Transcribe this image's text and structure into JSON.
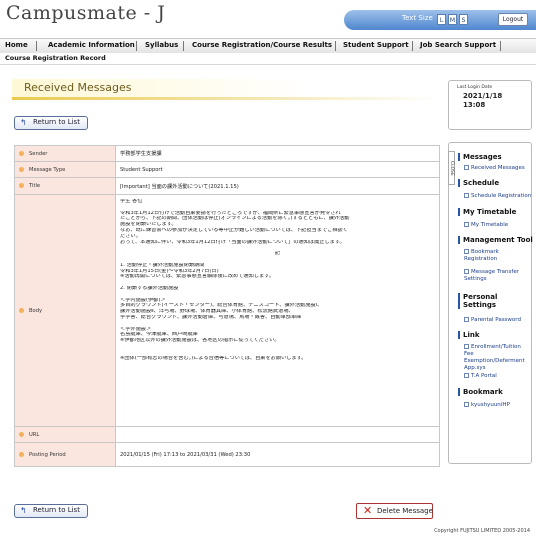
{
  "app": {
    "title": "Campusmate - J"
  },
  "topbar": {
    "text_size_label": "Text Size",
    "size_buttons": [
      "L",
      "M",
      "S"
    ],
    "logout_label": "Logout"
  },
  "nav": {
    "items": [
      "Home",
      "Academic Information",
      "Syllabus",
      "Course Registration/Course Results",
      "Student Support",
      "Job Search Support"
    ]
  },
  "subnav": {
    "items": [
      "Course Registration Record"
    ]
  },
  "page": {
    "title": "Received Messages",
    "return_label": "Return to List",
    "delete_label": "Delete Message"
  },
  "detail": {
    "rows": [
      {
        "label": "Sender",
        "value": "学務部学生支援課"
      },
      {
        "label": "Message Type",
        "value": "Student Support"
      },
      {
        "label": "Title",
        "value": "[Important] 当面の課外活動について(2021.1.15)"
      },
      {
        "label": "Body",
        "lines": [
          "学生 各位",
          "",
          "令和3年1月12日付けで活動自粛要請を行ったところですが、福岡県に緊急事態宣言が発令され",
          "たことから、下記の期間、団体活動は停止(オンラインによる活動を除く。)するとともに、課外活動",
          "施設を閉鎖いたします。",
          "なお、既に練習会への参加が決定している等中止が難しい活動については、下記担当までご相談く",
          "ださい。",
          "おって、本通知に伴い、令和3年1月12日付け「当面の課外活動について」の通知は廃止します。",
          "",
          "記",
          "",
          "1. 活動停止・課外活動施設閉鎖期間",
          "令和3年1月15日(金)～令和3年2月7日(日)",
          "※活動再開については、緊急事態宣言解除後に改めて通知します。",
          "",
          "2. 閉鎖する課外活動施設",
          "",
          "＜学内施設(伊都)＞",
          "多目的グラウンド(イースト・センター)、総合体育館、テニスコート、課外活動施設Ⅰ、",
          "課外活動施設Ⅱ、洋弓場、野球場、体育器具庫、小体育館、松流館武道場、",
          "学学舎、総合グラウンド、課外活動倉庫、弓道場、馬場・厩舎、自動車部車庫",
          "",
          "＜学外施設＞",
          "名島艇庫、今津艇庫、西戸崎艇庫",
          "※伊都地区以外の課外活動施設は、各地区の指示に従ってください。",
          "",
          "",
          "※団体(一部有志の場合を含む。)による合宿等については、自粛をお願いします。"
        ]
      },
      {
        "label": "URL",
        "value": ""
      },
      {
        "label": "Posting Period",
        "value": "2021/01/15 (Fri) 17:13 to 2021/03/31 (Wed) 23:30"
      }
    ]
  },
  "side": {
    "last_login_label": "Last Login Date",
    "last_login_date": "2021/1/18",
    "last_login_time": "13:08",
    "close_label": "CLOSE",
    "sections": [
      {
        "heading": "Messages",
        "links": [
          "Received Messages"
        ]
      },
      {
        "heading": "Schedule",
        "links": [
          "Schedule Registration"
        ]
      },
      {
        "heading": "My Timetable",
        "links": [
          "My Timetable"
        ]
      },
      {
        "heading": "Management Tool",
        "links": [
          "Bookmark Registration",
          "Message Transfer Settings"
        ]
      },
      {
        "heading": "Personal Settings",
        "links": [
          "Parental Password"
        ]
      },
      {
        "heading": "Link",
        "links": [
          "Enrollment/Tuition Fee Exemption/Deferment App.sys",
          "T.A Portal"
        ]
      },
      {
        "heading": "Bookmark",
        "links": [
          "kyushyuuniHP"
        ]
      }
    ]
  },
  "footer": {
    "copyright": "Copyright FUJITSU LIMITED 2005-2014"
  }
}
